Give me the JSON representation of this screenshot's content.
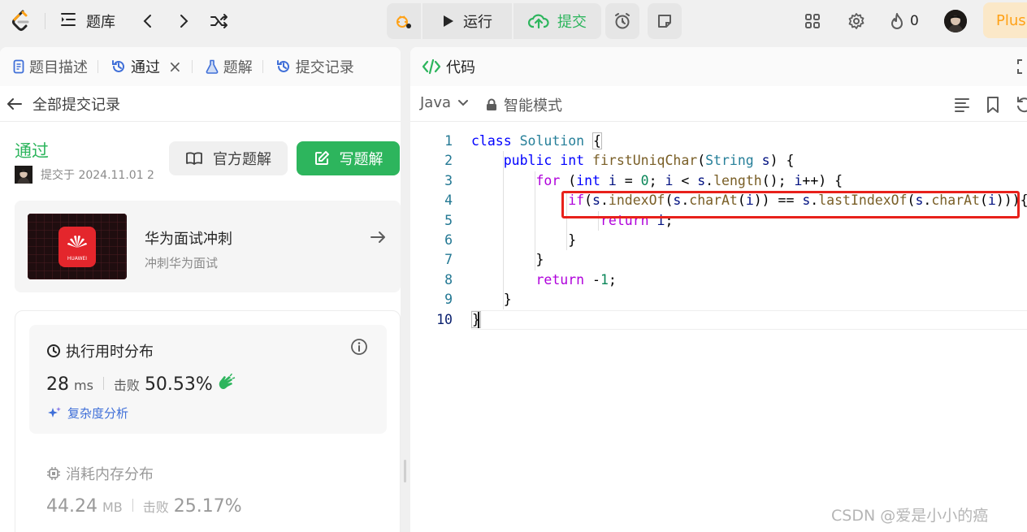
{
  "topbar": {
    "problem_list_label": "题库",
    "run_label": "运行",
    "submit_label": "提交",
    "streak_count": "0",
    "plus_label": "Plus",
    "colors": {
      "accent": "#ffa116",
      "success": "#2db55d"
    }
  },
  "left": {
    "tabs": [
      {
        "label": "题目描述",
        "icon": "document-icon"
      },
      {
        "label": "通过",
        "icon": "history-icon"
      },
      {
        "label": "题解",
        "icon": "flask-icon"
      },
      {
        "label": "提交记录",
        "icon": "history-icon"
      }
    ],
    "back_label": "全部提交记录",
    "status": "通过",
    "submitted_at": "提交于 2024.11.01 2",
    "official_solution_label": "官方题解",
    "write_solution_label": "写题解",
    "promo": {
      "title": "华为面试冲刺",
      "subtitle": "冲刺华为面试",
      "logo_text": "HUAWEI"
    },
    "runtime": {
      "heading": "执行用时分布",
      "value": "28",
      "unit": "ms",
      "beat_label": "击败",
      "beat_value": "50.53%",
      "complexity_label": "复杂度分析"
    },
    "memory": {
      "heading": "消耗内存分布",
      "value": "44.24",
      "unit": "MB",
      "beat_label": "击败",
      "beat_value": "25.17%"
    }
  },
  "right": {
    "tab_label": "代码",
    "language": "Java",
    "mode_label": "智能模式",
    "line_numbers": [
      "1",
      "2",
      "3",
      "4",
      "5",
      "6",
      "7",
      "8",
      "9",
      "10"
    ],
    "watermark": "CSDN @爱是小小的癌"
  }
}
